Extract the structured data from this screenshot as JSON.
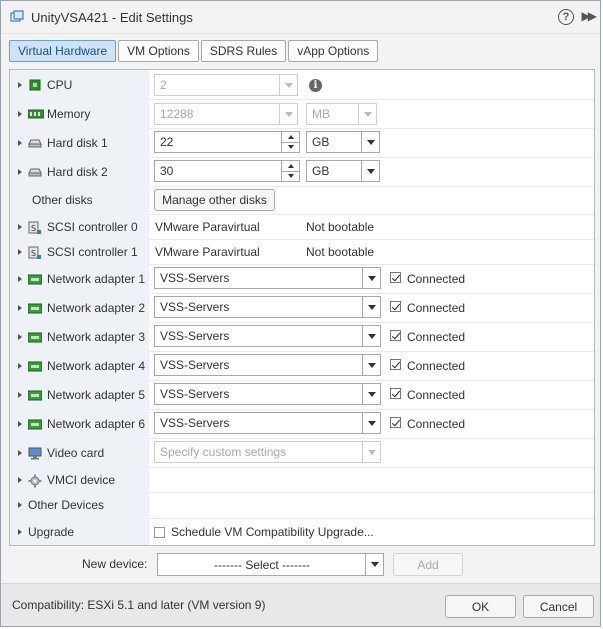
{
  "window": {
    "title": "UnityVSA421 - Edit Settings",
    "help_icon": "help-icon",
    "expand_icon": "double-chevron-right-icon"
  },
  "tabs": [
    {
      "label": "Virtual Hardware",
      "active": true
    },
    {
      "label": "VM Options",
      "active": false
    },
    {
      "label": "SDRS Rules",
      "active": false
    },
    {
      "label": "vApp Options",
      "active": false
    }
  ],
  "hardware": {
    "cpu": {
      "label": "CPU",
      "value": "2"
    },
    "memory": {
      "label": "Memory",
      "value": "12288",
      "unit": "MB"
    },
    "hard_disk_1": {
      "label": "Hard disk 1",
      "value": "22",
      "unit": "GB"
    },
    "hard_disk_2": {
      "label": "Hard disk 2",
      "value": "30",
      "unit": "GB"
    },
    "other_disks": {
      "label": "Other disks",
      "button": "Manage other disks"
    },
    "scsi_0": {
      "label": "SCSI controller 0",
      "type": "VMware Paravirtual",
      "boot": "Not bootable"
    },
    "scsi_1": {
      "label": "SCSI controller 1",
      "type": "VMware Paravirtual",
      "boot": "Not bootable"
    },
    "network_adapters": [
      {
        "label": "Network adapter 1",
        "network": "VSS-Servers",
        "connected_label": "Connected"
      },
      {
        "label": "Network adapter 2",
        "network": "VSS-Servers",
        "connected_label": "Connected"
      },
      {
        "label": "Network adapter 3",
        "network": "VSS-Servers",
        "connected_label": "Connected"
      },
      {
        "label": "Network adapter 4",
        "network": "VSS-Servers",
        "connected_label": "Connected"
      },
      {
        "label": "Network adapter 5",
        "network": "VSS-Servers",
        "connected_label": "Connected"
      },
      {
        "label": "Network adapter 6",
        "network": "VSS-Servers",
        "connected_label": "Connected"
      }
    ],
    "video_card": {
      "label": "Video card",
      "value": "Specify custom settings"
    },
    "vmci": {
      "label": "VMCI device"
    },
    "other_devices": {
      "label": "Other Devices"
    },
    "upgrade": {
      "label": "Upgrade",
      "checkbox_label": "Schedule VM Compatibility Upgrade..."
    }
  },
  "new_device": {
    "label": "New device:",
    "select_value": "------- Select -------",
    "add_button": "Add"
  },
  "footer": {
    "compatibility": "Compatibility: ESXi 5.1 and later (VM version 9)",
    "ok": "OK",
    "cancel": "Cancel"
  },
  "colors": {
    "accent_tab": "#cfe3f7",
    "label_column": "#eef2f6",
    "network_icon": "#3c9a3c"
  }
}
